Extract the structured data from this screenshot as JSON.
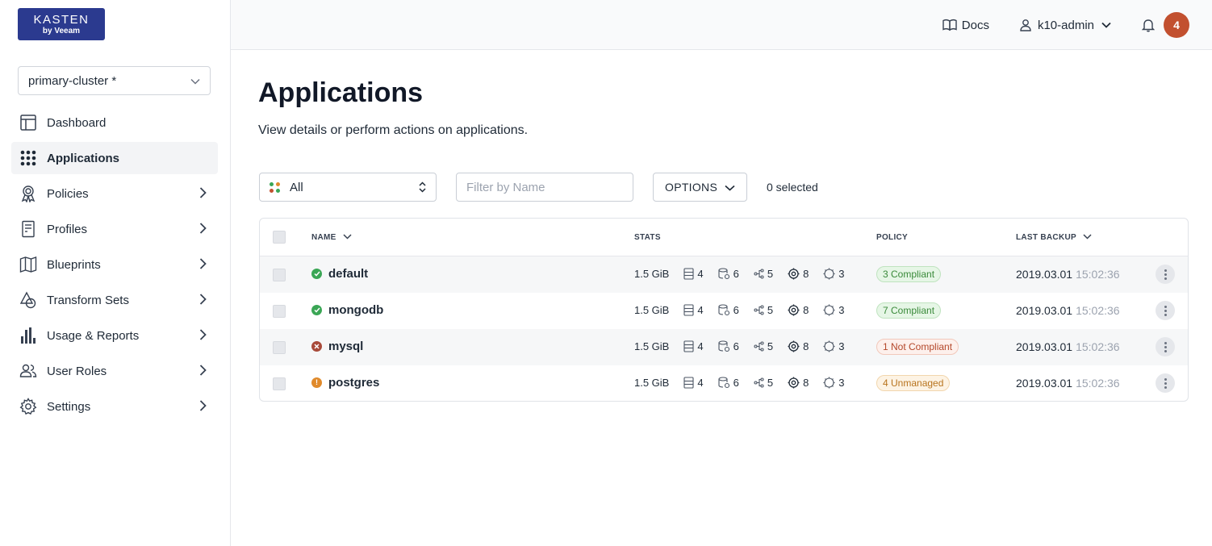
{
  "logo": {
    "brand": "KASTEN",
    "sub": "by Veeam"
  },
  "header": {
    "docs_label": "Docs",
    "user_label": "k10-admin",
    "notification_count": "4"
  },
  "sidebar": {
    "cluster": "primary-cluster *",
    "items": [
      {
        "label": "Dashboard",
        "icon": "dashboard-icon"
      },
      {
        "label": "Applications",
        "icon": "applications-grid-icon"
      },
      {
        "label": "Policies",
        "icon": "policy-ribbon-icon"
      },
      {
        "label": "Profiles",
        "icon": "profile-doc-icon"
      },
      {
        "label": "Blueprints",
        "icon": "map-icon"
      },
      {
        "label": "Transform Sets",
        "icon": "shapes-icon"
      },
      {
        "label": "Usage & Reports",
        "icon": "bar-chart-icon"
      },
      {
        "label": "User Roles",
        "icon": "users-icon"
      },
      {
        "label": "Settings",
        "icon": "gear-icon"
      }
    ]
  },
  "main": {
    "title": "Applications",
    "subtitle": "View details or perform actions on applications.",
    "filter_value": "All",
    "name_filter_placeholder": "Filter by Name",
    "options_label": "OPTIONS",
    "selected_text": "0 selected",
    "columns": {
      "name": "NAME",
      "stats": "STATS",
      "policy": "POLICY",
      "last_backup": "LAST BACKUP"
    },
    "rows": [
      {
        "name": "default",
        "status": "success",
        "size": "1.5 GiB",
        "s1": "4",
        "s2": "6",
        "s3": "5",
        "s4": "8",
        "s5": "3",
        "policy": "3 Compliant",
        "policy_kind": "ok",
        "date": "2019.03.01",
        "time": "15:02:36"
      },
      {
        "name": "mongodb",
        "status": "success",
        "size": "1.5 GiB",
        "s1": "4",
        "s2": "6",
        "s3": "5",
        "s4": "8",
        "s5": "3",
        "policy": "7 Compliant",
        "policy_kind": "ok",
        "date": "2019.03.01",
        "time": "15:02:36"
      },
      {
        "name": "mysql",
        "status": "error",
        "size": "1.5 GiB",
        "s1": "4",
        "s2": "6",
        "s3": "5",
        "s4": "8",
        "s5": "3",
        "policy": "1 Not Compliant",
        "policy_kind": "bad",
        "date": "2019.03.01",
        "time": "15:02:36"
      },
      {
        "name": "postgres",
        "status": "warning",
        "size": "1.5 GiB",
        "s1": "4",
        "s2": "6",
        "s3": "5",
        "s4": "8",
        "s5": "3",
        "policy": "4 Unmanaged",
        "policy_kind": "warn",
        "date": "2019.03.01",
        "time": "15:02:36"
      }
    ]
  },
  "colors": {
    "brand": "#2b3a8f",
    "badge": "#c2502f",
    "success": "#3aa655",
    "error": "#a84a3a",
    "warning": "#e08a2b"
  }
}
